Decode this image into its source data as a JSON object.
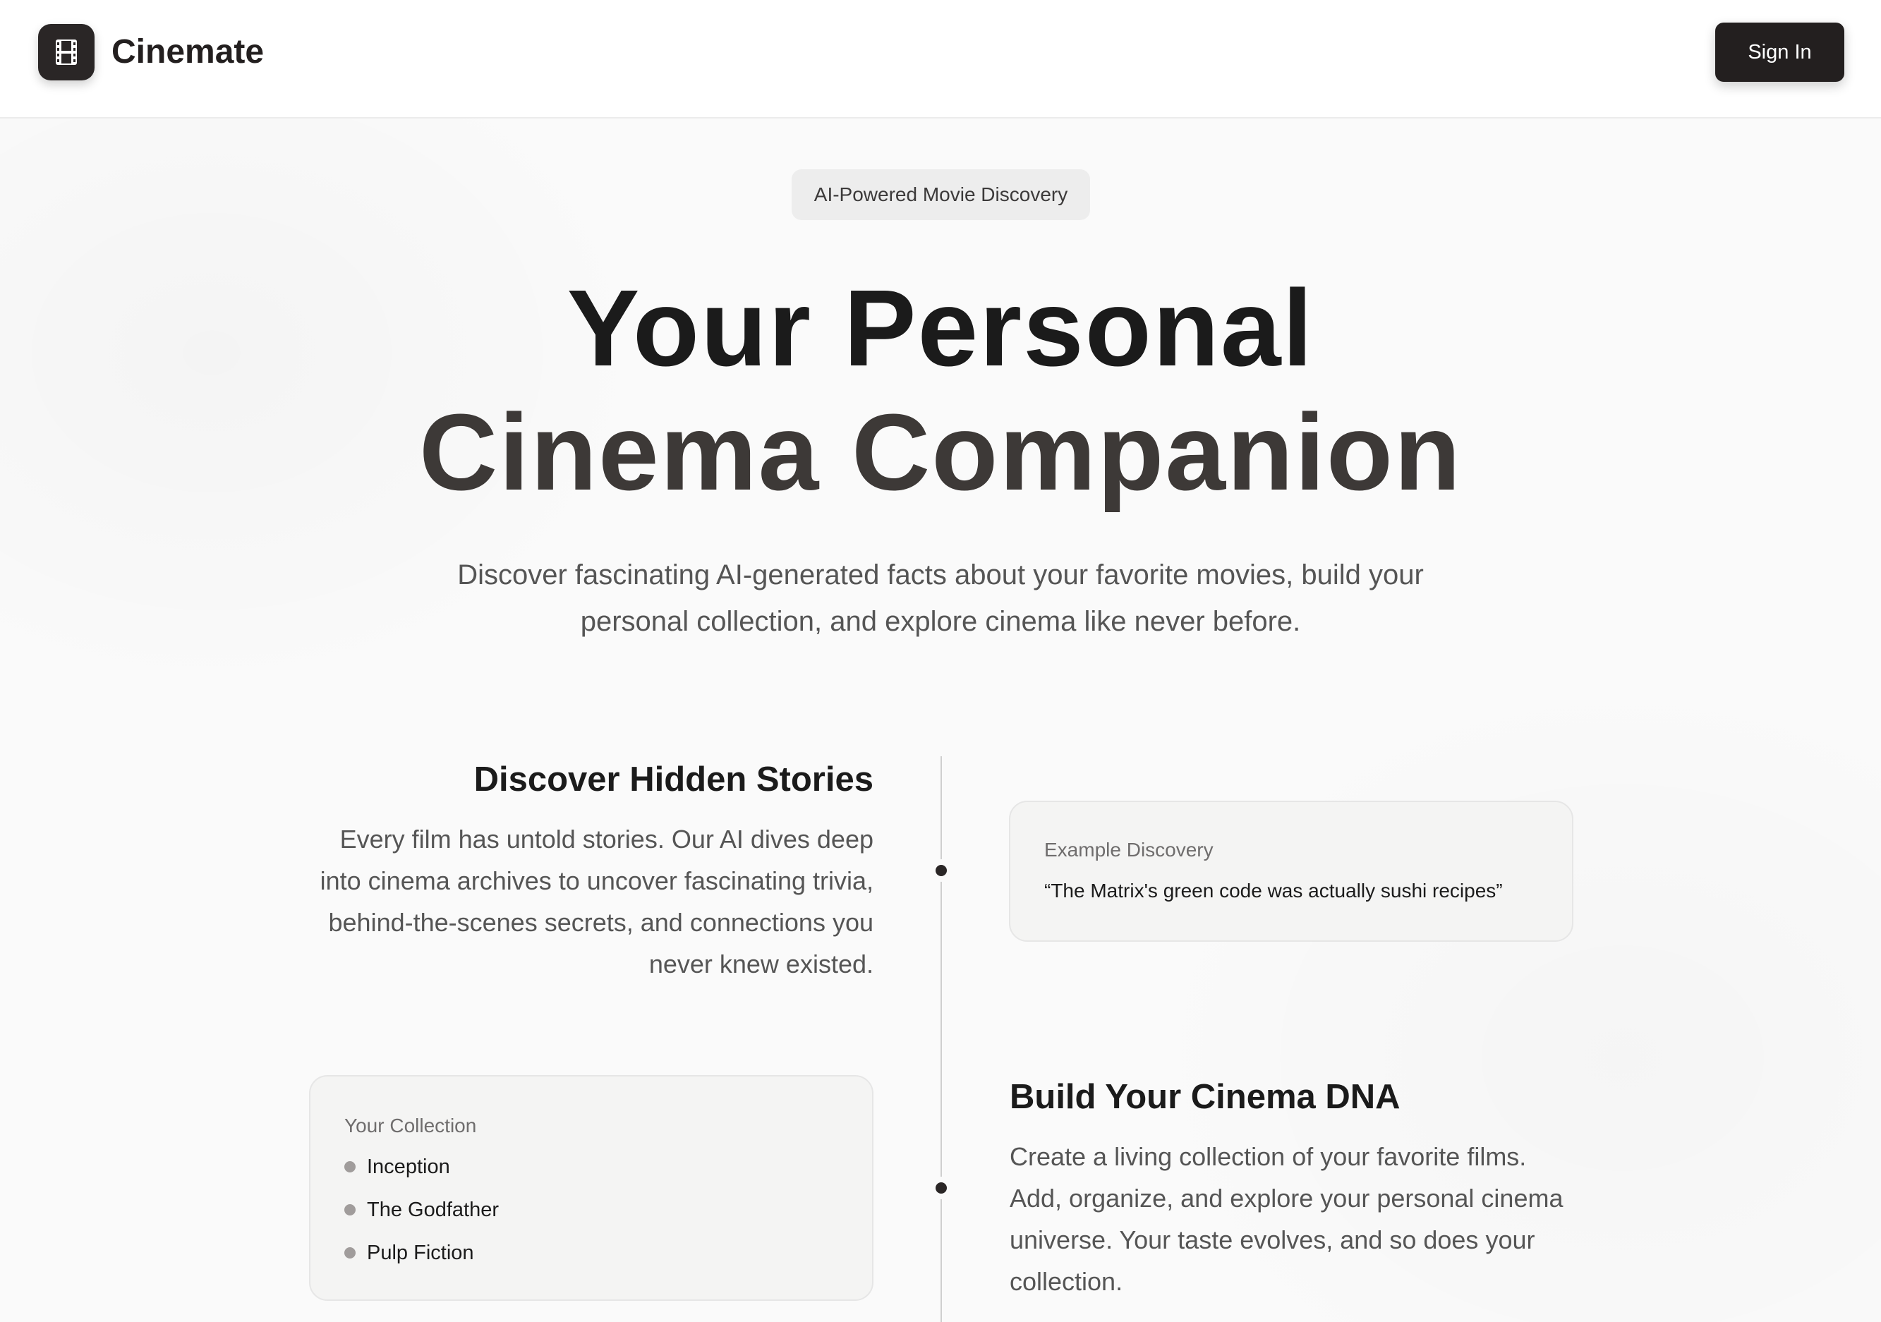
{
  "header": {
    "brand": "Cinemate",
    "logo_icon": "film-icon",
    "sign_in_label": "Sign In"
  },
  "hero": {
    "badge": "AI-Powered Movie Discovery",
    "title_line1": "Your Personal",
    "title_line2": "Cinema Companion",
    "subtitle": "Discover fascinating AI-generated facts about your favorite movies, build your personal collection, and explore cinema like never before."
  },
  "sections": [
    {
      "title": "Discover Hidden Stories",
      "body": "Every film has untold stories. Our AI dives deep into cinema archives to uncover fascinating trivia, behind-the-scenes secrets, and connections you never knew existed.",
      "card_label": "Example Discovery",
      "card_quote": "“The Matrix's green code was actually sushi recipes”"
    },
    {
      "title": "Build Your Cinema DNA",
      "body": "Create a living collection of your favorite films. Add, organize, and explore your personal cinema universe. Your taste evolves, and so does your collection.",
      "card_label": "Your Collection",
      "collection": [
        "Inception",
        "The Godfather",
        "Pulp Fiction"
      ]
    }
  ],
  "colors": {
    "accent_dark": "#231f1f",
    "background": "#fafafa",
    "card_bg": "#f4f4f3",
    "muted_text": "#555555"
  }
}
